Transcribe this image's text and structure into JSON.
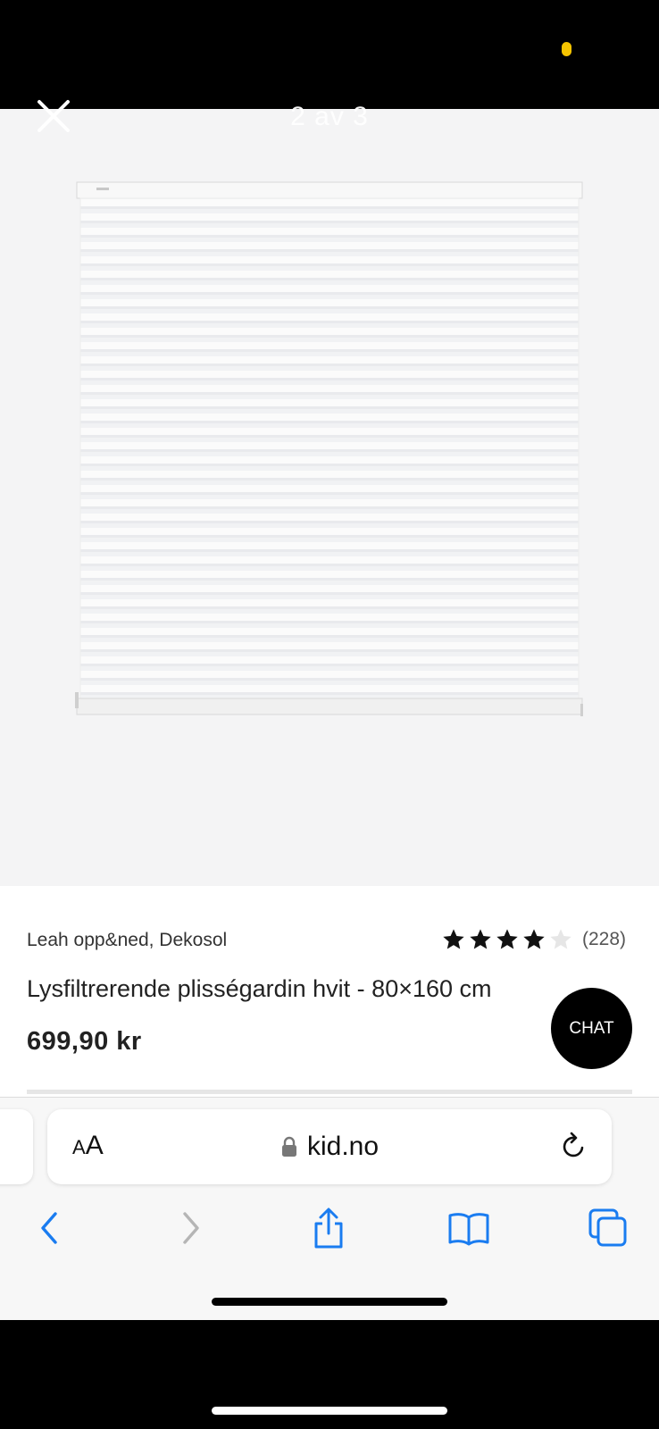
{
  "gallery": {
    "counter": "2 av 3"
  },
  "product": {
    "brand": "Leah opp&ned, Dekosol",
    "rating_stars": 4,
    "rating_max": 5,
    "review_count": "(228)",
    "title": "Lysfiltrerende plisségardin hvit - 80×160 cm",
    "price": "699,90 kr",
    "chat_label": "CHAT"
  },
  "browser": {
    "aa_label_small": "A",
    "aa_label_large": "A",
    "url": "kid.no"
  },
  "colors": {
    "accent_blue": "#1a7cf0",
    "disabled_gray": "#b5b5b5",
    "status_dot": "#f5c400"
  }
}
